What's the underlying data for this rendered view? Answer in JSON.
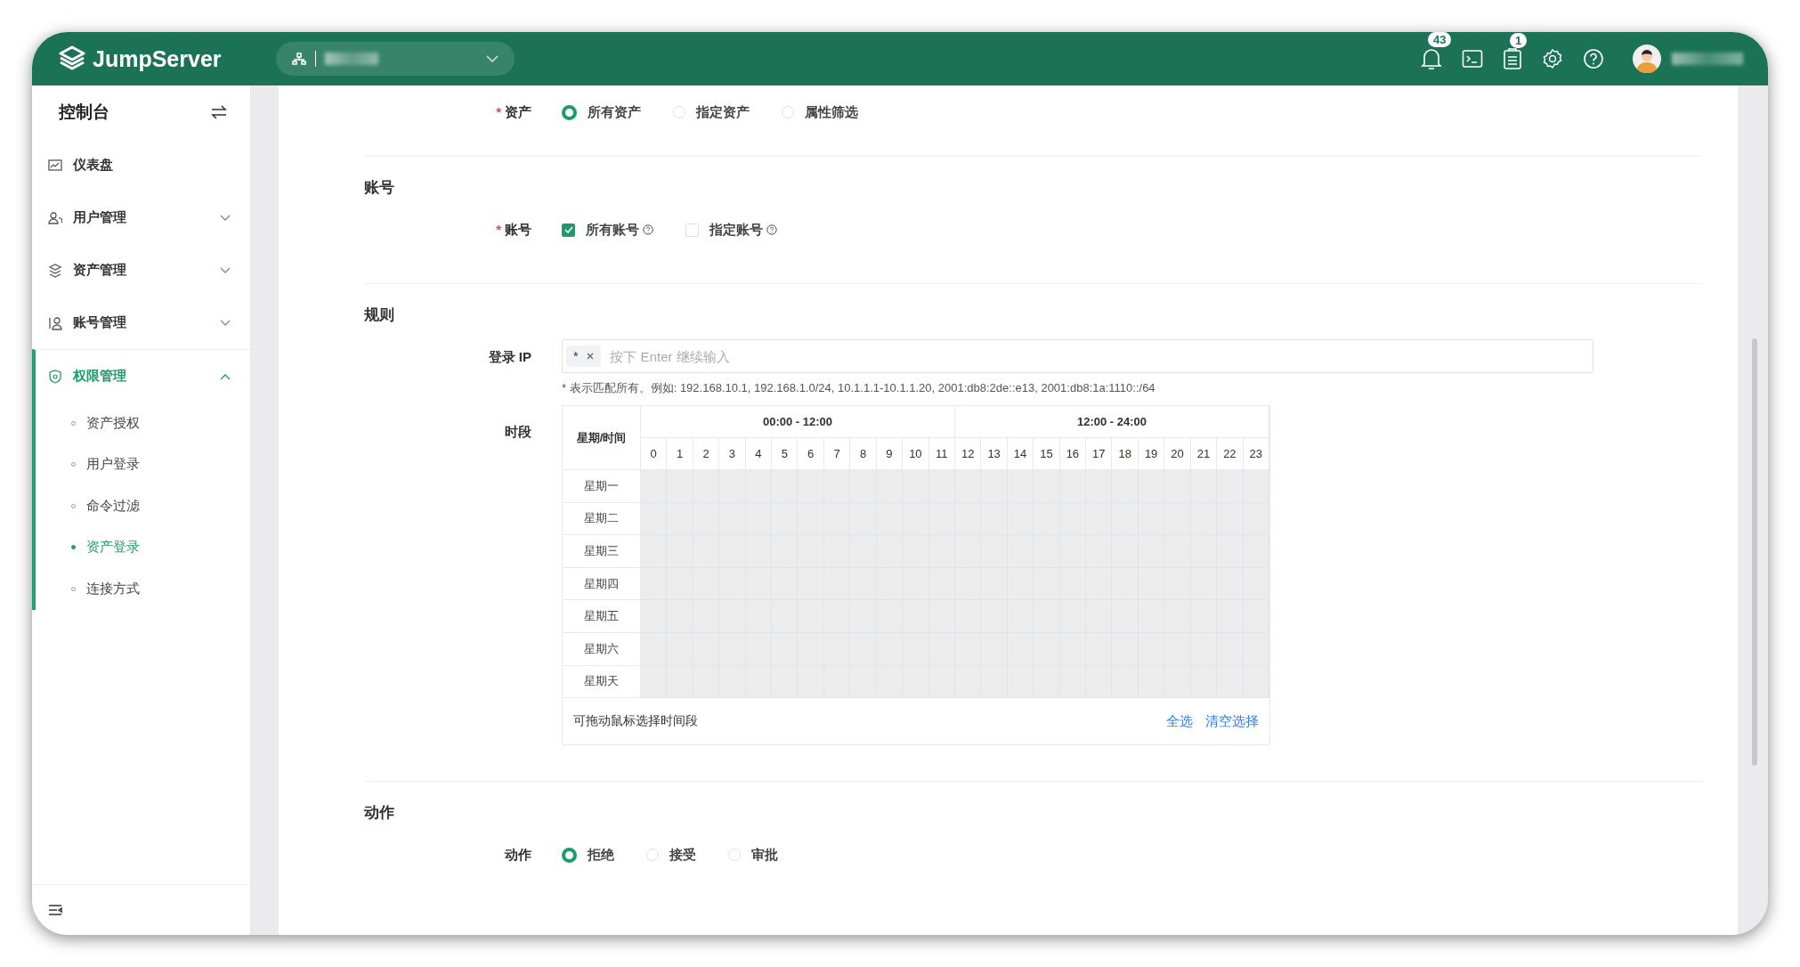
{
  "header": {
    "logo": "JumpServer",
    "badges": [
      {
        "kind": "bell",
        "count": "43"
      },
      {
        "kind": "terminal"
      },
      {
        "kind": "tasks",
        "count": "1"
      },
      {
        "kind": "settings"
      },
      {
        "kind": "help"
      }
    ]
  },
  "sidebar": {
    "title": "控制台",
    "items": [
      {
        "label": "仪表盘",
        "kind": "link",
        "selected": false
      },
      {
        "label": "用户管理",
        "kind": "group",
        "expanded": false,
        "selected": false
      },
      {
        "label": "资产管理",
        "kind": "group",
        "expanded": false,
        "selected": false
      },
      {
        "label": "账号管理",
        "kind": "group",
        "expanded": false,
        "selected": false
      },
      {
        "label": "权限管理",
        "kind": "group",
        "expanded": true,
        "selected": true,
        "children": [
          {
            "label": "资产授权",
            "selected": false
          },
          {
            "label": "用户登录",
            "selected": false
          },
          {
            "label": "命令过滤",
            "selected": false
          },
          {
            "label": "资产登录",
            "selected": true
          },
          {
            "label": "连接方式",
            "selected": false
          }
        ]
      }
    ]
  },
  "form": {
    "sections": [
      {
        "fields": [
          {
            "kind": "radio",
            "label": "资产",
            "required": true,
            "options": [
              {
                "label": "所有资产",
                "selected": true
              },
              {
                "label": "指定资产",
                "selected": false
              },
              {
                "label": "属性筛选",
                "selected": false
              }
            ]
          }
        ]
      },
      {
        "title": "账号",
        "fields": [
          {
            "kind": "checkbox",
            "label": "账号",
            "required": true,
            "options": [
              {
                "label": "所有账号",
                "checked": true,
                "help": true
              },
              {
                "label": "指定账号",
                "checked": false,
                "help": true
              }
            ]
          }
        ]
      },
      {
        "title": "规则",
        "fields": [
          {
            "kind": "tags",
            "label": "登录 IP",
            "required": false,
            "tags": [
              "*"
            ],
            "placeholder": "按下 Enter 继续输入",
            "hint": "* 表示匹配所有。例如: 192.168.10.1, 192.168.1.0/24, 10.1.1.1-10.1.1.20, 2001:db8:2de::e13, 2001:db8:1a:1110::/64"
          },
          {
            "kind": "schedule",
            "label": "时段",
            "required": false,
            "corner": "星期/时间",
            "ranges": [
              "00:00 - 12:00",
              "12:00 - 24:00"
            ],
            "hours": [
              "0",
              "1",
              "2",
              "3",
              "4",
              "5",
              "6",
              "7",
              "8",
              "9",
              "10",
              "11",
              "12",
              "13",
              "14",
              "15",
              "16",
              "17",
              "18",
              "19",
              "20",
              "21",
              "22",
              "23"
            ],
            "days": [
              "星期一",
              "星期二",
              "星期三",
              "星期四",
              "星期五",
              "星期六",
              "星期天"
            ],
            "footer_hint": "可拖动鼠标选择时间段",
            "actions": [
              "全选",
              "清空选择"
            ]
          }
        ]
      },
      {
        "title": "动作",
        "fields": [
          {
            "kind": "radio",
            "label": "动作",
            "required": false,
            "options": [
              {
                "label": "拒绝",
                "selected": true
              },
              {
                "label": "接受",
                "selected": false
              },
              {
                "label": "审批",
                "selected": false
              }
            ]
          }
        ]
      }
    ]
  }
}
